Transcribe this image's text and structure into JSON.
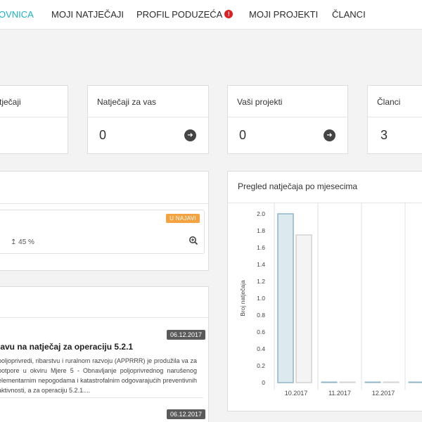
{
  "nav": {
    "items": [
      {
        "label": "OVNICA",
        "active": true
      },
      {
        "label": "MOJI NATJEČAJI"
      },
      {
        "label": "PROFIL PODUZEĆA",
        "alert": "!"
      },
      {
        "label": "MOJI PROJEKTI"
      },
      {
        "label": "ČLANCI"
      }
    ]
  },
  "stats": [
    {
      "title": "tječaji",
      "value": ""
    },
    {
      "title": "Natječaji za vas",
      "value": "0"
    },
    {
      "title": "Vaši projekti",
      "value": "0"
    },
    {
      "title": "Članci",
      "value": "3"
    }
  ],
  "najavi_card": {
    "badge": "U NAJAVI",
    "mark": "",
    "percent": "↥ 45 %"
  },
  "articles": [
    {
      "date": "06.12.2017",
      "title": "lavu na natječaj za operaciju 5.2.1",
      "text": "poljoprivredi, ribarstvu i ruralnom razvoju (APPRRR) je produžila va za potpore u okviru Mjere 5 - Obnavljanje poljoprivrednog narušenog elementarnim nepogodama i katastrofalnim odgovarajućih preventivnih aktivnosti, a za operaciju 5.2.1...."
    },
    {
      "date": "06.12.2017",
      "title": "...",
      "text": ""
    }
  ],
  "chart_data": {
    "type": "bar",
    "title": "Pregled natječaja po mjesecima",
    "ylabel": "Broj natječaja",
    "xlabel": "",
    "categories": [
      "10.2017",
      "11.2017",
      "12.2017",
      ""
    ],
    "series": [
      {
        "values": [
          2,
          0,
          0,
          0
        ],
        "color": "#dce9ef",
        "stroke": "#8fb5c6"
      },
      {
        "values": [
          1.75,
          0,
          0,
          0
        ],
        "color": "#f4f4f4",
        "stroke": "#d2d2d2"
      }
    ],
    "ylim": [
      0,
      2
    ],
    "yticks": [
      "2.0",
      "1.8",
      "1.6",
      "1.4",
      "1.2",
      "1.0",
      "0.8",
      "0.6",
      "0.4",
      "0.2",
      "0"
    ],
    "grid": true
  }
}
